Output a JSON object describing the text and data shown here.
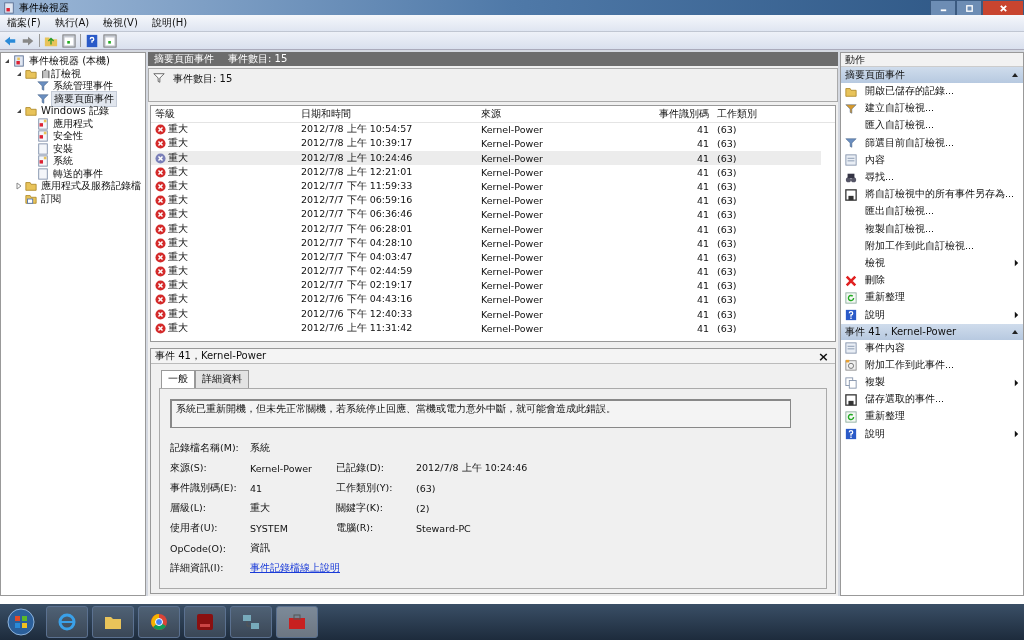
{
  "window": {
    "title": "事件檢視器"
  },
  "menu": [
    "檔案(F)",
    "執行(A)",
    "檢視(V)",
    "說明(H)"
  ],
  "toolbar": [
    {
      "kind": "back"
    },
    {
      "kind": "forward"
    },
    {
      "kind": "sep"
    },
    {
      "kind": "up"
    },
    {
      "kind": "pane"
    },
    {
      "kind": "sep"
    },
    {
      "kind": "help"
    },
    {
      "kind": "pane"
    }
  ],
  "tree": [
    {
      "label": "事件檢視器 (本機)",
      "kind": "viewer",
      "selected": false,
      "expanded": true,
      "children": [
        {
          "label": "自訂檢視",
          "kind": "folder",
          "selected": false,
          "expanded": true,
          "children": [
            {
              "label": "系統管理事件",
              "kind": "filter",
              "selected": false
            },
            {
              "label": "摘要頁面事件",
              "kind": "filter",
              "selected": true
            }
          ]
        },
        {
          "label": "Windows 記錄",
          "kind": "folder",
          "selected": false,
          "expanded": true,
          "children": [
            {
              "label": "應用程式",
              "kind": "log",
              "selected": false
            },
            {
              "label": "安全性",
              "kind": "log",
              "selected": false
            },
            {
              "label": "安裝",
              "kind": "page",
              "selected": false
            },
            {
              "label": "系統",
              "kind": "log",
              "selected": false
            },
            {
              "label": "轉送的事件",
              "kind": "page",
              "selected": false
            }
          ]
        },
        {
          "label": "應用程式及服務記錄檔",
          "kind": "folder",
          "selected": false,
          "expanded": false
        },
        {
          "label": "訂閱",
          "kind": "subs",
          "selected": false
        }
      ]
    }
  ],
  "center": {
    "title": "摘要頁面事件",
    "count": "事件數目: 15",
    "filter_text": "事件數目: 15"
  },
  "table": {
    "columns": [
      "等級",
      "日期和時間",
      "來源",
      "事件識別碼",
      "工作類別"
    ],
    "rows": [
      {
        "level": "重大",
        "date": "2012/7/8 上午 10:54:57",
        "source": "Kernel-Power",
        "id": "41",
        "task": "(63)",
        "selected": false
      },
      {
        "level": "重大",
        "date": "2012/7/8 上午 10:39:17",
        "source": "Kernel-Power",
        "id": "41",
        "task": "(63)",
        "selected": false
      },
      {
        "level": "重大",
        "date": "2012/7/8 上午 10:24:46",
        "source": "Kernel-Power",
        "id": "41",
        "task": "(63)",
        "selected": true
      },
      {
        "level": "重大",
        "date": "2012/7/8 上午 12:21:01",
        "source": "Kernel-Power",
        "id": "41",
        "task": "(63)",
        "selected": false
      },
      {
        "level": "重大",
        "date": "2012/7/7 下午 11:59:33",
        "source": "Kernel-Power",
        "id": "41",
        "task": "(63)",
        "selected": false
      },
      {
        "level": "重大",
        "date": "2012/7/7 下午 06:59:16",
        "source": "Kernel-Power",
        "id": "41",
        "task": "(63)",
        "selected": false
      },
      {
        "level": "重大",
        "date": "2012/7/7 下午 06:36:46",
        "source": "Kernel-Power",
        "id": "41",
        "task": "(63)",
        "selected": false
      },
      {
        "level": "重大",
        "date": "2012/7/7 下午 06:28:01",
        "source": "Kernel-Power",
        "id": "41",
        "task": "(63)",
        "selected": false
      },
      {
        "level": "重大",
        "date": "2012/7/7 下午 04:28:10",
        "source": "Kernel-Power",
        "id": "41",
        "task": "(63)",
        "selected": false
      },
      {
        "level": "重大",
        "date": "2012/7/7 下午 04:03:47",
        "source": "Kernel-Power",
        "id": "41",
        "task": "(63)",
        "selected": false
      },
      {
        "level": "重大",
        "date": "2012/7/7 下午 02:44:59",
        "source": "Kernel-Power",
        "id": "41",
        "task": "(63)",
        "selected": false
      },
      {
        "level": "重大",
        "date": "2012/7/7 下午 02:19:17",
        "source": "Kernel-Power",
        "id": "41",
        "task": "(63)",
        "selected": false
      },
      {
        "level": "重大",
        "date": "2012/7/6 下午 04:43:16",
        "source": "Kernel-Power",
        "id": "41",
        "task": "(63)",
        "selected": false
      },
      {
        "level": "重大",
        "date": "2012/7/6 下午 12:40:33",
        "source": "Kernel-Power",
        "id": "41",
        "task": "(63)",
        "selected": false
      },
      {
        "level": "重大",
        "date": "2012/7/6 上午 11:31:42",
        "source": "Kernel-Power",
        "id": "41",
        "task": "(63)",
        "selected": false
      }
    ]
  },
  "detail": {
    "title": "事件 41，Kernel-Power",
    "close": "×",
    "tabs": [
      {
        "label": "一般",
        "selected": true
      },
      {
        "label": "詳細資料",
        "selected": false
      }
    ],
    "message": "系統已重新開機，但未先正常關機，若系統停止回應、當機或電力意外中斷，就可能會造成此錯誤。",
    "fields": [
      [
        {
          "label": "記錄檔名稱(M):",
          "value": "系統"
        }
      ],
      [
        {
          "label": "來源(S):",
          "value": "Kernel-Power"
        },
        {
          "label": "已記錄(D):",
          "value": "2012/7/8 上午 10:24:46"
        }
      ],
      [
        {
          "label": "事件識別碼(E):",
          "value": "41"
        },
        {
          "label": "工作類別(Y):",
          "value": "(63)"
        }
      ],
      [
        {
          "label": "層級(L):",
          "value": "重大"
        },
        {
          "label": "關鍵字(K):",
          "value": "(2)"
        }
      ],
      [
        {
          "label": "使用者(U):",
          "value": "SYSTEM"
        },
        {
          "label": "電腦(R):",
          "value": "Steward-PC"
        }
      ],
      [
        {
          "label": "OpCode(O):",
          "value": "資訊"
        }
      ],
      [
        {
          "label": "詳細資訊(I):",
          "value": "事件記錄檔線上說明",
          "kind": "link"
        }
      ]
    ]
  },
  "actions": {
    "title": "動作",
    "sections": [
      {
        "title": "摘要頁面事件",
        "expanded": true,
        "items": [
          {
            "label": "開啟已儲存的記錄...",
            "kind": "folder",
            "submenu": false
          },
          {
            "label": "建立自訂檢視...",
            "kind": "filter-add",
            "submenu": false
          },
          {
            "label": "匯入自訂檢視...",
            "kind": "none",
            "submenu": false
          },
          {
            "label": "篩選目前自訂檢視...",
            "kind": "filter",
            "submenu": false
          },
          {
            "label": "內容",
            "kind": "props",
            "submenu": false
          },
          {
            "label": "尋找...",
            "kind": "find",
            "submenu": false
          },
          {
            "label": "將自訂檢視中的所有事件另存為...",
            "kind": "save",
            "submenu": false
          },
          {
            "label": "匯出自訂檢視...",
            "kind": "none",
            "submenu": false
          },
          {
            "label": "複製自訂檢視...",
            "kind": "none",
            "submenu": false
          },
          {
            "label": "附加工作到此自訂檢視...",
            "kind": "none",
            "submenu": false
          },
          {
            "label": "檢視",
            "kind": "none",
            "submenu": true
          },
          {
            "label": "刪除",
            "kind": "delete",
            "submenu": false
          },
          {
            "label": "重新整理",
            "kind": "refresh",
            "submenu": false
          },
          {
            "label": "說明",
            "kind": "help",
            "submenu": true
          }
        ]
      },
      {
        "title": "事件 41，Kernel-Power",
        "expanded": true,
        "items": [
          {
            "label": "事件內容",
            "kind": "props",
            "submenu": false
          },
          {
            "label": "附加工作到此事件...",
            "kind": "task",
            "submenu": false
          },
          {
            "label": "複製",
            "kind": "copy",
            "submenu": true
          },
          {
            "label": "儲存選取的事件...",
            "kind": "save",
            "submenu": false
          },
          {
            "label": "重新整理",
            "kind": "refresh",
            "submenu": false
          },
          {
            "label": "說明",
            "kind": "help",
            "submenu": true
          }
        ]
      }
    ]
  },
  "taskbar": [
    {
      "kind": "start"
    },
    {
      "kind": "browser",
      "selected": false
    },
    {
      "kind": "folder",
      "selected": false
    },
    {
      "kind": "chrome",
      "selected": false
    },
    {
      "kind": "red-app",
      "selected": false
    },
    {
      "kind": "network",
      "selected": false
    },
    {
      "kind": "toolbox",
      "selected": true
    }
  ]
}
